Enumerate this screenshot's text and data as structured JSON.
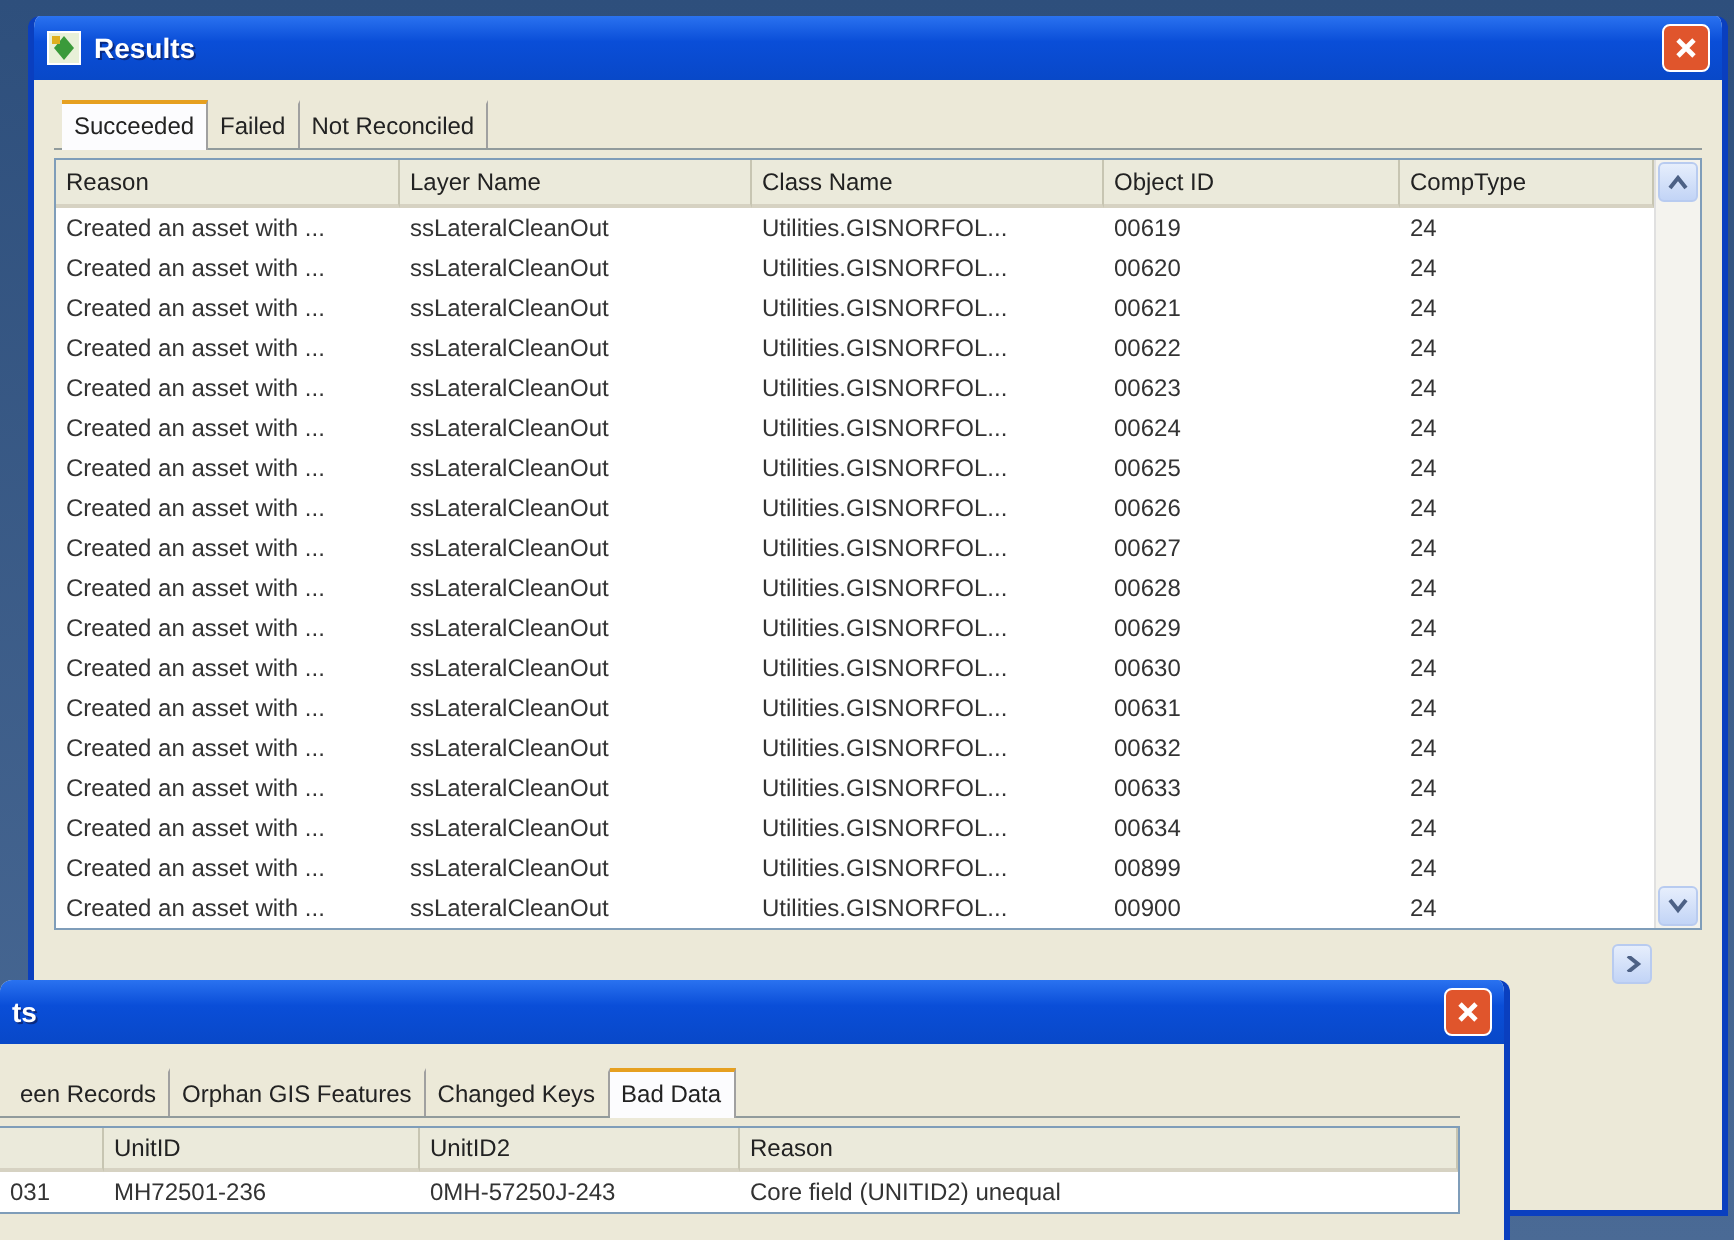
{
  "main_window": {
    "title": "Results",
    "tabs": [
      {
        "label": "Succeeded",
        "selected": true
      },
      {
        "label": "Failed",
        "selected": false
      },
      {
        "label": "Not Reconciled",
        "selected": false
      }
    ],
    "table": {
      "columns": [
        "Reason",
        "Layer Name",
        "Class Name",
        "Object ID",
        "CompType"
      ],
      "rows": [
        [
          "Created an asset with ...",
          "ssLateralCleanOut",
          "Utilities.GISNORFOL...",
          "00619",
          "24"
        ],
        [
          "Created an asset with ...",
          "ssLateralCleanOut",
          "Utilities.GISNORFOL...",
          "00620",
          "24"
        ],
        [
          "Created an asset with ...",
          "ssLateralCleanOut",
          "Utilities.GISNORFOL...",
          "00621",
          "24"
        ],
        [
          "Created an asset with ...",
          "ssLateralCleanOut",
          "Utilities.GISNORFOL...",
          "00622",
          "24"
        ],
        [
          "Created an asset with ...",
          "ssLateralCleanOut",
          "Utilities.GISNORFOL...",
          "00623",
          "24"
        ],
        [
          "Created an asset with ...",
          "ssLateralCleanOut",
          "Utilities.GISNORFOL...",
          "00624",
          "24"
        ],
        [
          "Created an asset with ...",
          "ssLateralCleanOut",
          "Utilities.GISNORFOL...",
          "00625",
          "24"
        ],
        [
          "Created an asset with ...",
          "ssLateralCleanOut",
          "Utilities.GISNORFOL...",
          "00626",
          "24"
        ],
        [
          "Created an asset with ...",
          "ssLateralCleanOut",
          "Utilities.GISNORFOL...",
          "00627",
          "24"
        ],
        [
          "Created an asset with ...",
          "ssLateralCleanOut",
          "Utilities.GISNORFOL...",
          "00628",
          "24"
        ],
        [
          "Created an asset with ...",
          "ssLateralCleanOut",
          "Utilities.GISNORFOL...",
          "00629",
          "24"
        ],
        [
          "Created an asset with ...",
          "ssLateralCleanOut",
          "Utilities.GISNORFOL...",
          "00630",
          "24"
        ],
        [
          "Created an asset with ...",
          "ssLateralCleanOut",
          "Utilities.GISNORFOL...",
          "00631",
          "24"
        ],
        [
          "Created an asset with ...",
          "ssLateralCleanOut",
          "Utilities.GISNORFOL...",
          "00632",
          "24"
        ],
        [
          "Created an asset with ...",
          "ssLateralCleanOut",
          "Utilities.GISNORFOL...",
          "00633",
          "24"
        ],
        [
          "Created an asset with ...",
          "ssLateralCleanOut",
          "Utilities.GISNORFOL...",
          "00634",
          "24"
        ],
        [
          "Created an asset with ...",
          "ssLateralCleanOut",
          "Utilities.GISNORFOL...",
          "00899",
          "24"
        ],
        [
          "Created an asset with ...",
          "ssLateralCleanOut",
          "Utilities.GISNORFOL...",
          "00900",
          "24"
        ]
      ]
    }
  },
  "front_window": {
    "title": "ts",
    "tabs": [
      {
        "label": "een Records",
        "selected": false
      },
      {
        "label": "Orphan GIS Features",
        "selected": false
      },
      {
        "label": "Changed Keys",
        "selected": false
      },
      {
        "label": "Bad Data",
        "selected": true
      }
    ],
    "table": {
      "columns": [
        "",
        "UnitID",
        "UnitID2",
        "Reason"
      ],
      "rows": [
        [
          "031",
          "MH72501-236",
          "0MH-57250J-243",
          "Core field (UNITID2) unequal"
        ]
      ]
    }
  }
}
